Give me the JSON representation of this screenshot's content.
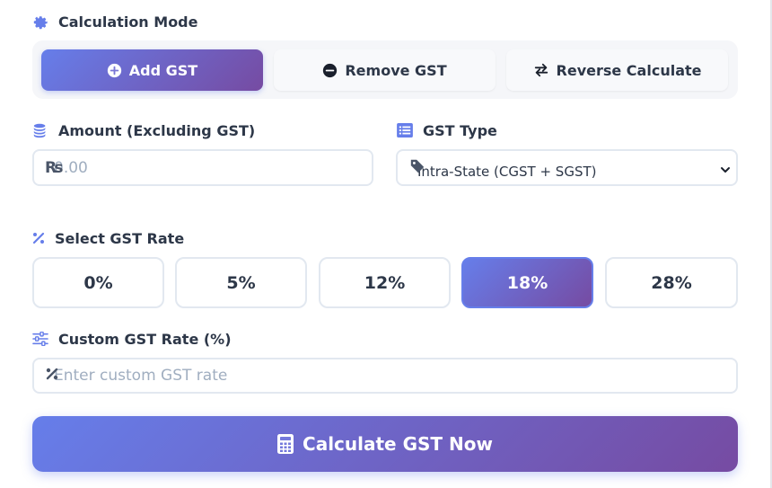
{
  "mode_section": {
    "label": "Calculation Mode",
    "icon": "gear-icon",
    "buttons": [
      {
        "label": "Add GST",
        "icon": "plus-circle-icon",
        "active": true
      },
      {
        "label": "Remove GST",
        "icon": "minus-circle-icon",
        "active": false
      },
      {
        "label": "Reverse Calculate",
        "icon": "exchange-icon",
        "active": false
      }
    ]
  },
  "amount": {
    "label": "Amount (Excluding GST)",
    "icon": "coins-icon",
    "prefix": "₨",
    "placeholder": "0.00",
    "value": ""
  },
  "gst_type": {
    "label": "GST Type",
    "icon": "list-icon",
    "selected": "Intra-State (CGST + SGST)"
  },
  "rate_section": {
    "label": "Select GST Rate",
    "icon": "percent-icon",
    "rates": [
      "0%",
      "5%",
      "12%",
      "18%",
      "28%"
    ],
    "active_index": 3
  },
  "custom_rate": {
    "label": "Custom GST Rate (%)",
    "icon": "sliders-icon",
    "placeholder": "Enter custom GST rate",
    "value": ""
  },
  "calculate": {
    "label": "Calculate GST Now",
    "icon": "calculator-icon"
  },
  "colors": {
    "accent_start": "#667eea",
    "accent_end": "#764ba2",
    "text": "#2d3748",
    "border": "#e2e8f0"
  }
}
